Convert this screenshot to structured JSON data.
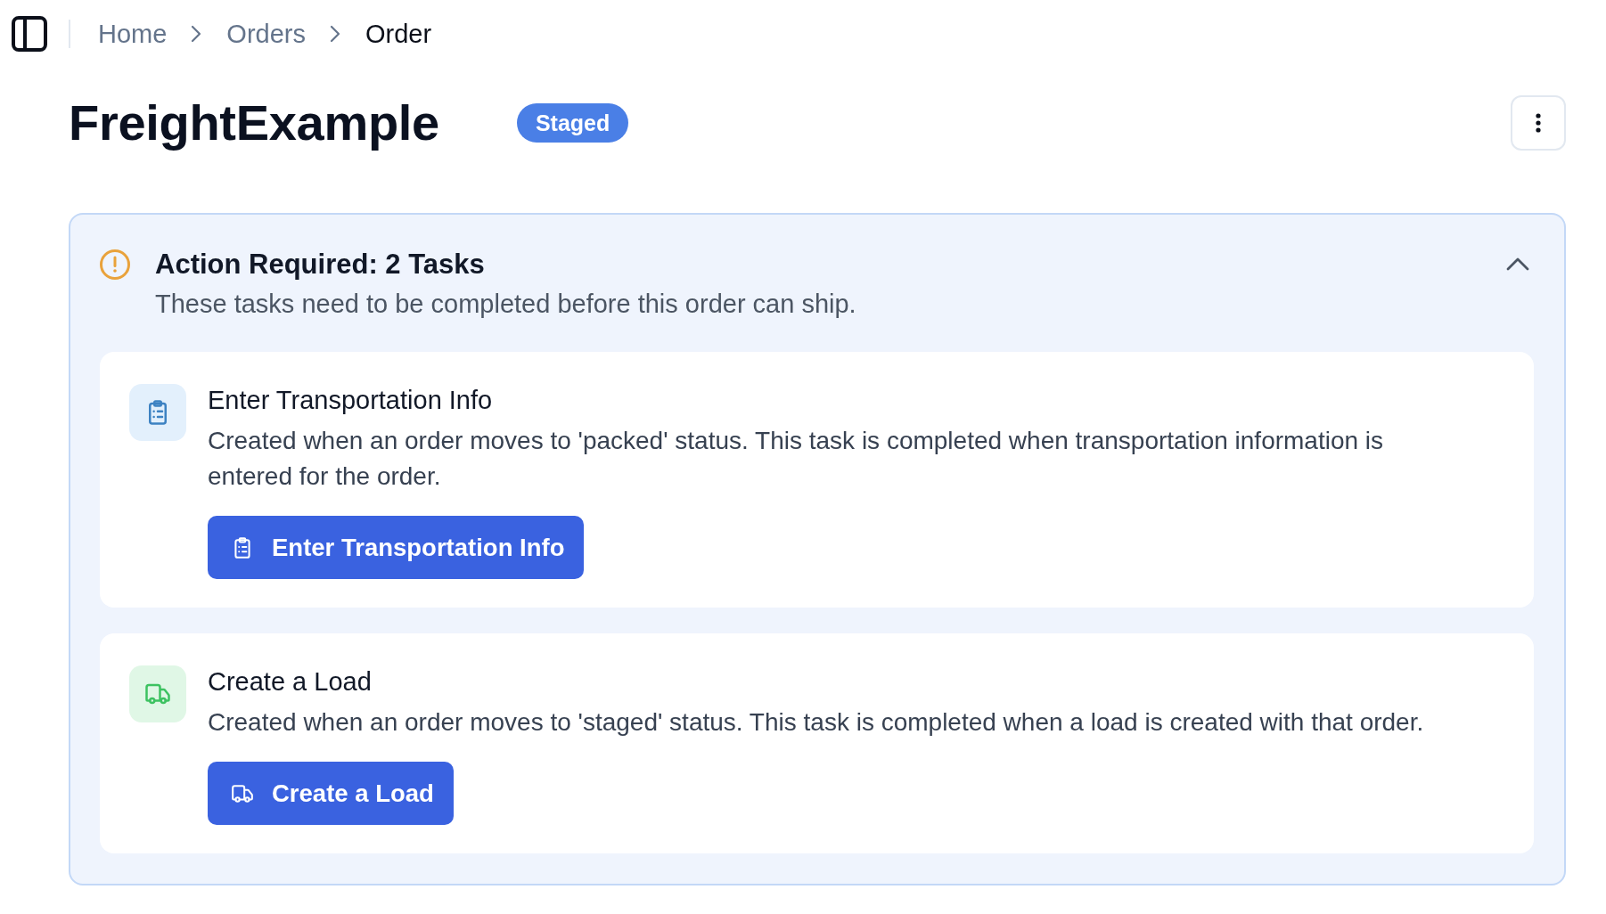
{
  "topbar": {
    "breadcrumb": [
      {
        "label": "Home",
        "current": false
      },
      {
        "label": "Orders",
        "current": false
      },
      {
        "label": "Order",
        "current": true
      }
    ]
  },
  "header": {
    "title": "FreightExample",
    "status_badge": "Staged"
  },
  "alert": {
    "title": "Action Required: 2 Tasks",
    "subtitle": "These tasks need to be completed before this order can ship.",
    "expanded": true,
    "tasks": [
      {
        "kind": "clipboard",
        "color": "#e3f0fc",
        "title": "Enter Transportation Info",
        "description": "Created when an order moves to 'packed' status. This task is completed when transportation information is entered for the order.",
        "button": "Enter Transportation Info"
      },
      {
        "kind": "truck",
        "color": "#e0f7e6",
        "title": "Create a Load",
        "description": "Created when an order moves to 'staged' status. This task is completed when a load is created with that order.",
        "button": "Create a Load"
      }
    ]
  }
}
